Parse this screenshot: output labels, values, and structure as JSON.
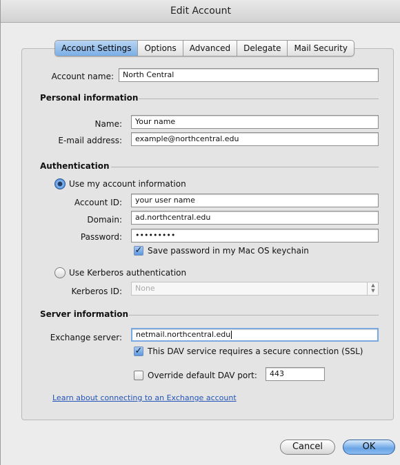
{
  "window": {
    "title": "Edit Account"
  },
  "tabs": [
    "Account Settings",
    "Options",
    "Advanced",
    "Delegate",
    "Mail Security"
  ],
  "account": {
    "name_label": "Account name:",
    "name_value": "North Central"
  },
  "personal": {
    "heading": "Personal information",
    "name_label": "Name:",
    "name_value": "Your name",
    "email_label": "E-mail address:",
    "email_value": "example@northcentral.edu"
  },
  "auth": {
    "heading": "Authentication",
    "use_account_label": "Use my account information",
    "account_id_label": "Account ID:",
    "account_id_value": "your user name",
    "domain_label": "Domain:",
    "domain_value": "ad.northcentral.edu",
    "password_label": "Password:",
    "password_value": "•••••••••",
    "save_password_label": "Save password in my Mac OS keychain",
    "kerberos_label": "Use Kerberos authentication",
    "kerberos_id_label": "Kerberos ID:",
    "kerberos_id_value": "None"
  },
  "server": {
    "heading": "Server information",
    "exchange_label": "Exchange server:",
    "exchange_value": "netmail.northcentral.edu",
    "ssl_label": "This DAV service requires a secure connection (SSL)",
    "override_label": "Override default DAV port:",
    "port_value": "443"
  },
  "link_text": "Learn about connecting to an Exchange account",
  "buttons": {
    "cancel": "Cancel",
    "ok": "OK"
  },
  "colors": {
    "accent": "#5c98df",
    "link": "#2254b8"
  }
}
